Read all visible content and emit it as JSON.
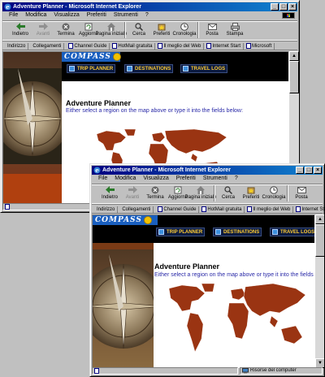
{
  "window": {
    "title": "Adventure Planner - Microsoft Internet Explorer",
    "controls": [
      "_",
      "□",
      "×"
    ]
  },
  "menu": [
    "File",
    "Modifica",
    "Visualizza",
    "Preferiti",
    "Strumenti",
    "?"
  ],
  "toolbar": {
    "back": "Indietro",
    "forward": "Avanti",
    "stop": "Termina",
    "refresh": "Aggiorna",
    "home": "Pagina iniziale",
    "search": "Cerca",
    "favorites": "Preferiti",
    "history": "Cronologia",
    "mail": "Posta",
    "print": "Stampa"
  },
  "links_bar": {
    "address_label": "Indirizzo",
    "links_label": "Collegamenti",
    "links": [
      "Channel Guide",
      "HotMail gratuita",
      "Il meglio del Web",
      "Internet Start",
      "Microsoft"
    ]
  },
  "page": {
    "logo": "COMPASS",
    "nav": [
      "TRIP PLANNER",
      "DESTINATIONS",
      "TRAVEL LOGS"
    ],
    "title": "Adventure Planner",
    "instructions": "Either select a region on the map above or type it into the fields below:"
  },
  "status": {
    "zone": "Risorse del computer"
  },
  "colors": {
    "title_bar": "#000080",
    "map_land": "#9a3412",
    "nav_text": "#ffcc33",
    "instructions_text": "#2a2aa8"
  }
}
